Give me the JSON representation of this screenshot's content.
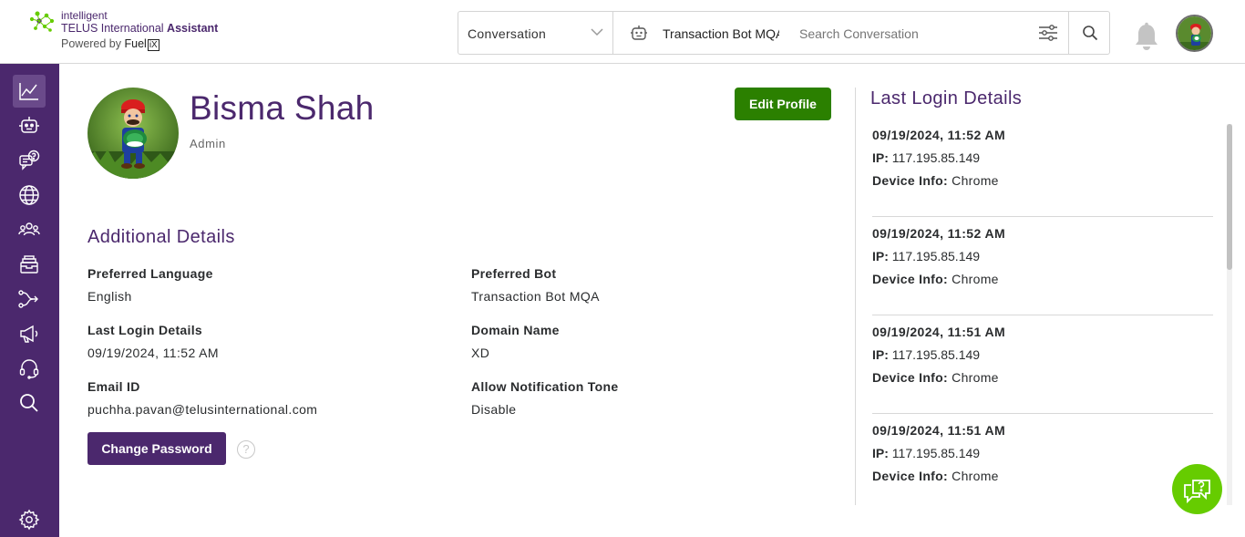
{
  "brand": {
    "line1": "intelligent",
    "line2_regular": "TELUS International ",
    "line2_bold": "Assistant",
    "line3_prefix": "Powered by ",
    "line3_fuel": "Fuel",
    "line3_ix": "iX"
  },
  "header": {
    "conversation_select": "Conversation",
    "bot_value": "Transaction Bot MQA",
    "search_placeholder": "Search Conversation",
    "icons": [
      "chevron-down-icon",
      "bot-icon",
      "filter-sliders-icon",
      "search-icon",
      "bell-icon",
      "avatar"
    ]
  },
  "sidebar": {
    "items": [
      {
        "icon": "analytics-chart-icon",
        "active": true
      },
      {
        "icon": "bot-icon"
      },
      {
        "icon": "faq-chat-icon"
      },
      {
        "icon": "globe-icon"
      },
      {
        "icon": "users-group-icon"
      },
      {
        "icon": "inbox-archive-icon"
      },
      {
        "icon": "flow-route-icon"
      },
      {
        "icon": "megaphone-icon"
      },
      {
        "icon": "headset-icon"
      },
      {
        "icon": "search-icon"
      },
      {
        "icon": "settings-gear-icon"
      }
    ]
  },
  "profile": {
    "name": "Bisma Shah",
    "role": "Admin",
    "edit_label": "Edit Profile"
  },
  "details": {
    "title": "Additional Details",
    "preferred_language_label": "Preferred Language",
    "preferred_language": "English",
    "preferred_bot_label": "Preferred Bot",
    "preferred_bot": "Transaction Bot MQA",
    "last_login_label": "Last Login Details",
    "last_login": "09/19/2024, 11:52 AM",
    "domain_label": "Domain Name",
    "domain": "XD",
    "email_label": "Email ID",
    "email": "puchha.pavan@telusinternational.com",
    "notification_label": "Allow Notification Tone",
    "notification": "Disable",
    "change_password_label": "Change Password",
    "help_glyph": "?"
  },
  "last_login": {
    "title": "Last Login Details",
    "ip_label": "IP:",
    "device_label": "Device Info:",
    "entries": [
      {
        "datetime": "09/19/2024, 11:52 AM",
        "ip": "117.195.85.149",
        "device": "Chrome"
      },
      {
        "datetime": "09/19/2024, 11:52 AM",
        "ip": "117.195.85.149",
        "device": "Chrome"
      },
      {
        "datetime": "09/19/2024, 11:51 AM",
        "ip": "117.195.85.149",
        "device": "Chrome"
      },
      {
        "datetime": "09/19/2024, 11:51 AM",
        "ip": "117.195.85.149",
        "device": "Chrome"
      }
    ]
  },
  "colors": {
    "brand_purple": "#4b286d",
    "brand_green": "#2b8000",
    "fab_green": "#66cc00"
  }
}
